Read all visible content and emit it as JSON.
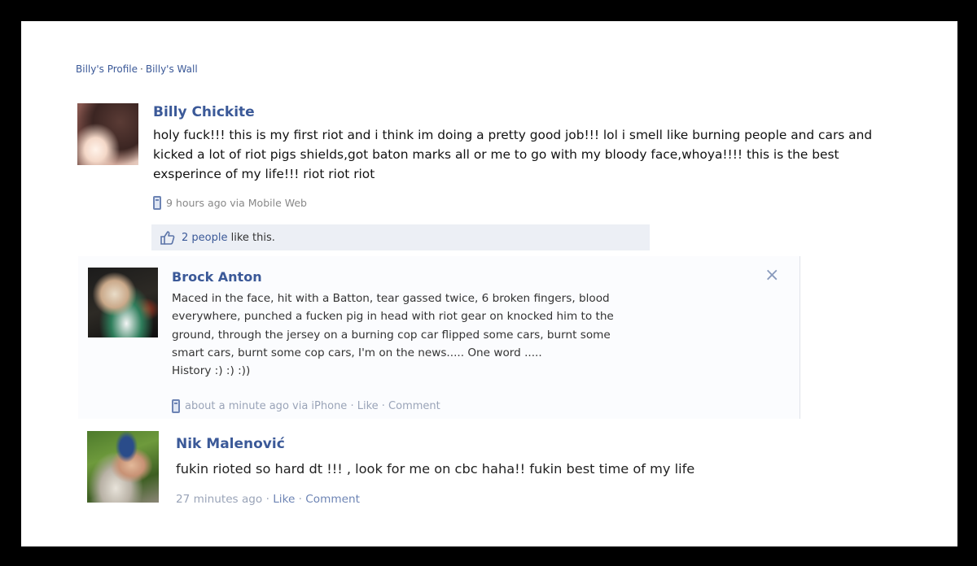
{
  "breadcrumb": {
    "profile": "Billy's Profile",
    "separator": "·",
    "wall": "Billy's Wall"
  },
  "post": {
    "author": "Billy Chickite",
    "text": "holy fuck!!! this is my first riot and i think im doing a pretty good job!!! lol i smell like burning people and cars and kicked a lot of riot pigs shields,got baton marks all or me to go with my bloody face,whoya!!!! this is the best exsperince of my life!!! riot riot riot",
    "meta": "9 hours ago via Mobile Web",
    "likes_count": "2 people",
    "likes_suffix": " like this."
  },
  "comments": [
    {
      "author": "Brock Anton",
      "text_lines": [
        "Maced in the face, hit with a Batton, tear gassed twice, 6 broken fingers, blood",
        "everywhere, punched a fucken pig in head with riot gear on knocked him to the",
        "ground, through the jersey on a burning cop car flipped some cars, burnt some",
        "smart cars, burnt some cop cars, I'm on the news..... One word .....",
        "History :) :) :))"
      ],
      "time": "about a minute ago via iPhone",
      "sep": " · ",
      "like": "Like",
      "comment": "Comment",
      "close": "×"
    },
    {
      "author": "Nik Malenović",
      "text": "fukin rioted so hard dt !!! , look for me on cbc haha!! fukin best time of my life",
      "time": "27 minutes ago",
      "sep": " · ",
      "like": "Like",
      "comment": "Comment"
    }
  ],
  "icons": {
    "mobile": "mobile-phone-icon",
    "thumb": "thumbs-up-icon",
    "close": "close-icon"
  },
  "colors": {
    "link": "#3b5998",
    "like_bar": "#eceff5",
    "meta": "#888888"
  }
}
